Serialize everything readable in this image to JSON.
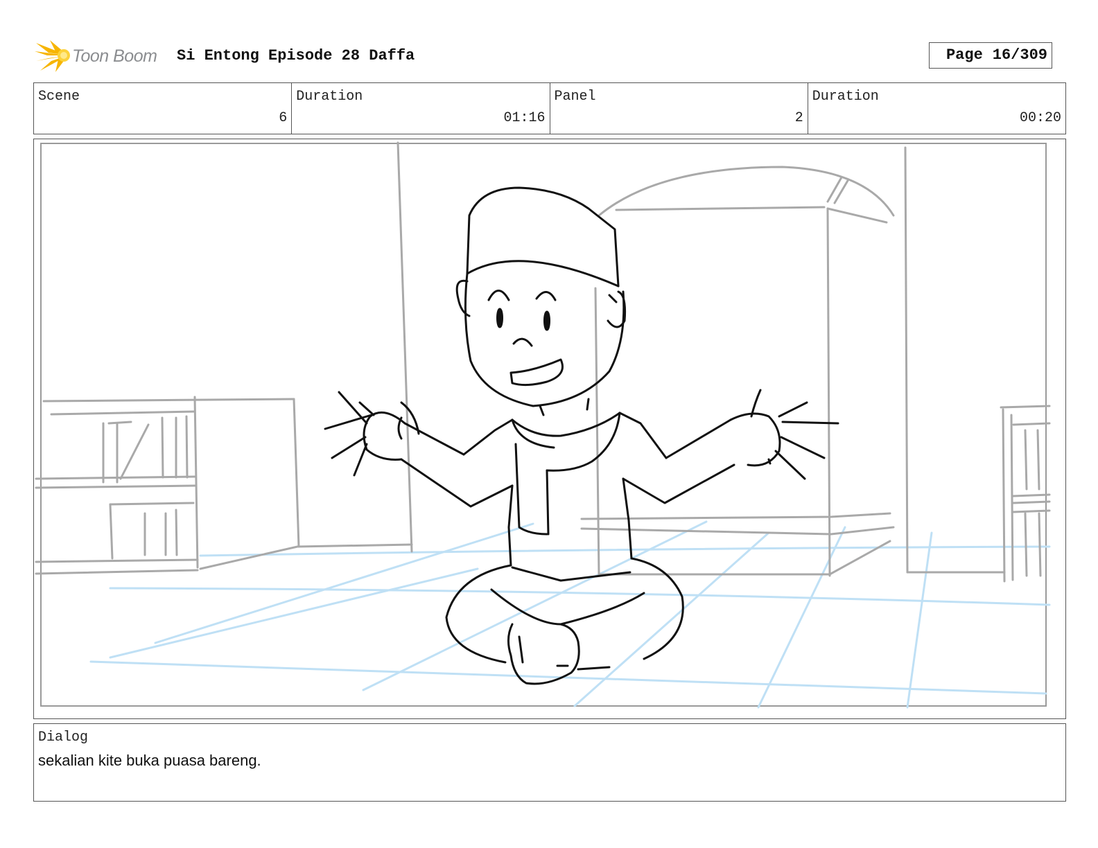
{
  "header": {
    "logo_text": "Toon Boom",
    "project_title": "Si Entong Episode 28 Daffa",
    "page_label": "Page",
    "page_value": "16/309"
  },
  "info": {
    "scene_label": "Scene",
    "scene_value": "6",
    "scene_duration_label": "Duration",
    "scene_duration_value": "01:16",
    "panel_label": "Panel",
    "panel_value": "2",
    "panel_duration_label": "Duration",
    "panel_duration_value": "00:20"
  },
  "dialog": {
    "label": "Dialog",
    "text": "sekalian kite buka puasa bareng."
  },
  "colors": {
    "logo_accent": "#f7b500",
    "sketch_black": "#111111",
    "sketch_gray": "#a9a9a9",
    "sketch_blue": "#bfe0f5"
  }
}
